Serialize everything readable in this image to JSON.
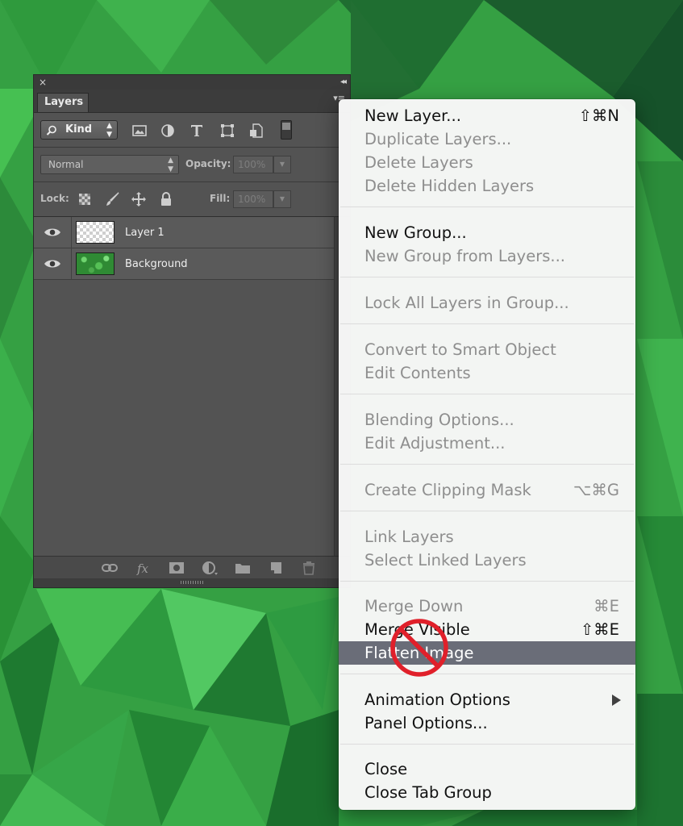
{
  "panel": {
    "close_glyph": "×",
    "collapse_glyph": "◂◂",
    "tab_label": "Layers",
    "menu_glyph": "▾≡",
    "kind_label": "Kind",
    "filter_icons": [
      "image-icon",
      "adjustment-circle-icon",
      "type-icon",
      "shape-transform-icon",
      "smart-object-icon"
    ],
    "blend_mode": "Normal",
    "opacity_label": "Opacity:",
    "opacity_value": "100%",
    "lock_label": "Lock:",
    "fill_label": "Fill:",
    "fill_value": "100%",
    "layers": [
      {
        "name": "Layer 1",
        "thumb": "transparent"
      },
      {
        "name": "Background",
        "thumb": "green-texture"
      }
    ],
    "footer_icons": [
      "link-icon",
      "fx-icon",
      "mask-icon",
      "adjustment-icon",
      "folder-icon",
      "new-layer-icon",
      "trash-icon"
    ]
  },
  "menu": {
    "groups": [
      [
        {
          "label": "New Layer...",
          "shortcut": "⇧⌘N",
          "enabled": true
        },
        {
          "label": "Duplicate Layers...",
          "enabled": false
        },
        {
          "label": "Delete Layers",
          "enabled": false
        },
        {
          "label": "Delete Hidden Layers",
          "enabled": false
        }
      ],
      [
        {
          "label": "New Group...",
          "enabled": true
        },
        {
          "label": "New Group from Layers...",
          "enabled": false
        }
      ],
      [
        {
          "label": "Lock All Layers in Group...",
          "enabled": false
        }
      ],
      [
        {
          "label": "Convert to Smart Object",
          "enabled": false
        },
        {
          "label": "Edit Contents",
          "enabled": false
        }
      ],
      [
        {
          "label": "Blending Options...",
          "enabled": false
        },
        {
          "label": "Edit Adjustment...",
          "enabled": false
        }
      ],
      [
        {
          "label": "Create Clipping Mask",
          "shortcut": "⌥⌘G",
          "enabled": false
        }
      ],
      [
        {
          "label": "Link Layers",
          "enabled": false
        },
        {
          "label": "Select Linked Layers",
          "enabled": false
        }
      ],
      [
        {
          "label": "Merge Down",
          "shortcut": "⌘E",
          "enabled": false
        },
        {
          "label": "Merge Visible",
          "shortcut": "⇧⌘E",
          "enabled": true
        },
        {
          "label": "Flatten Image",
          "enabled": true,
          "highlighted": true
        }
      ],
      [
        {
          "label": "Animation Options",
          "enabled": true,
          "submenu": true
        },
        {
          "label": "Panel Options...",
          "enabled": true
        }
      ],
      [
        {
          "label": "Close",
          "enabled": true
        },
        {
          "label": "Close Tab Group",
          "enabled": true
        }
      ]
    ]
  },
  "colors": {
    "menu_highlight": "#6a6d78",
    "prohibited_red": "#e0202a",
    "panel_bg": "#535353"
  },
  "overlay": {
    "cursor_icon": "prohibited-icon"
  }
}
